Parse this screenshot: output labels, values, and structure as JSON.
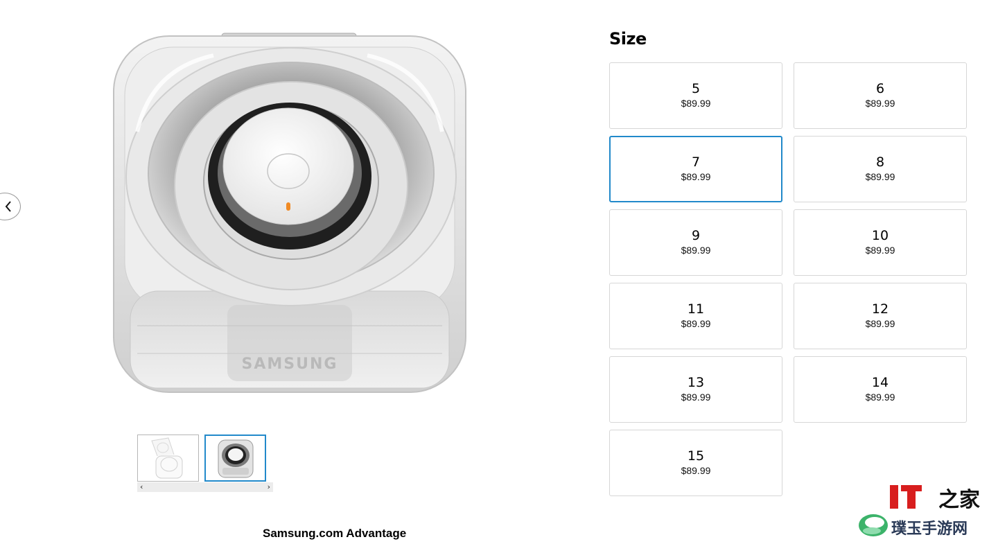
{
  "gallery": {
    "main_image": {
      "icon": "ring-charging-case-image",
      "brand_text": "SAMSUNG",
      "accent_color": "#f08a24"
    },
    "prev_icon": "chevron-left-icon",
    "thumbnails": [
      {
        "icon": "case-open-thumbnail",
        "selected": false
      },
      {
        "icon": "case-top-thumbnail",
        "selected": true
      }
    ],
    "thumb_scroll": {
      "left_icon": "‹",
      "right_icon": "›"
    }
  },
  "advantage_label": "Samsung.com Advantage",
  "size_section": {
    "title": "Size",
    "selected_index": 2,
    "selected_color": "#2189ca",
    "options": [
      {
        "size": "5",
        "price": "$89.99"
      },
      {
        "size": "6",
        "price": "$89.99"
      },
      {
        "size": "7",
        "price": "$89.99"
      },
      {
        "size": "8",
        "price": "$89.99"
      },
      {
        "size": "9",
        "price": "$89.99"
      },
      {
        "size": "10",
        "price": "$89.99"
      },
      {
        "size": "11",
        "price": "$89.99"
      },
      {
        "size": "12",
        "price": "$89.99"
      },
      {
        "size": "13",
        "price": "$89.99"
      },
      {
        "size": "14",
        "price": "$89.99"
      },
      {
        "size": "15",
        "price": "$89.99"
      }
    ]
  },
  "watermark": {
    "top_text": "IT之家",
    "bottom_text": "璞玉手游网",
    "colors": {
      "it_red": "#d81e1e",
      "leaf_green": "#3cb36a",
      "text_dark": "#2a3a57"
    }
  }
}
